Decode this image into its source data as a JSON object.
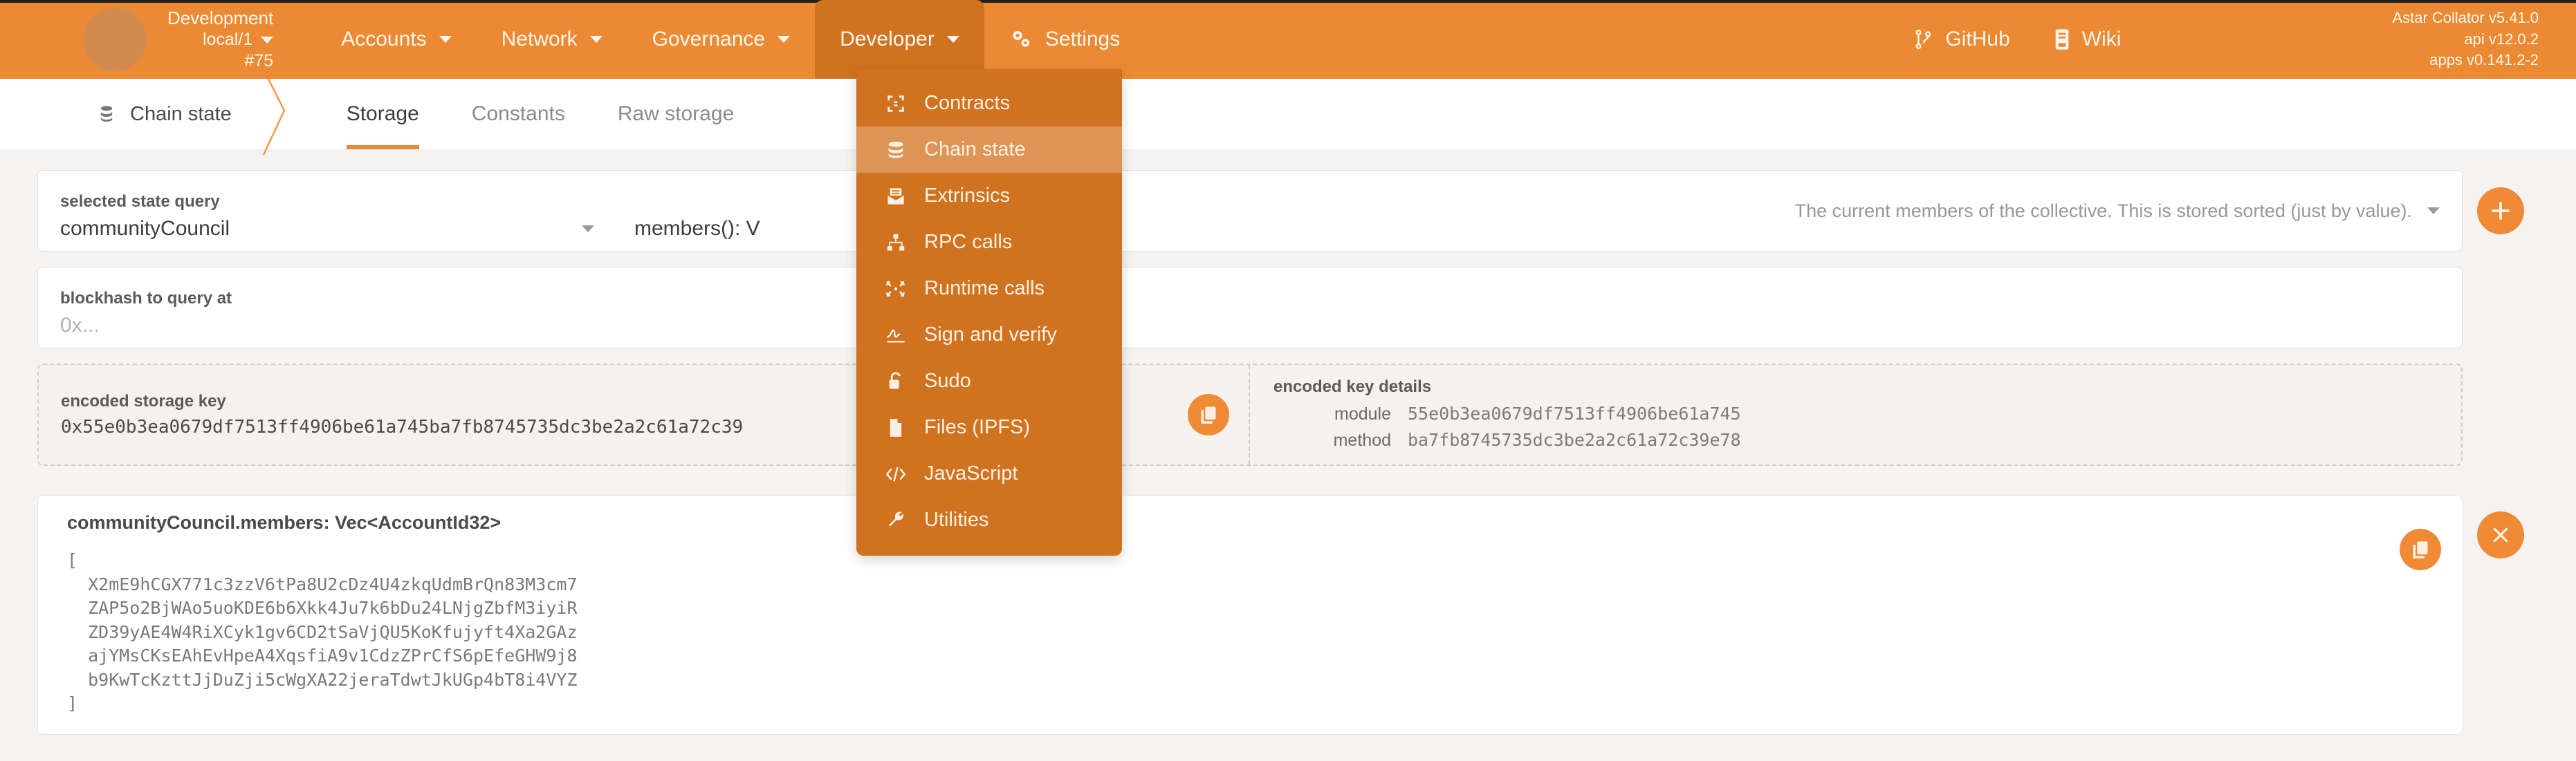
{
  "header": {
    "chain": {
      "name": "Development",
      "node": "local/1",
      "block": "#75"
    },
    "nav": [
      {
        "label": "Accounts",
        "has_caret": true,
        "active": false
      },
      {
        "label": "Network",
        "has_caret": true,
        "active": false
      },
      {
        "label": "Governance",
        "has_caret": true,
        "active": false
      },
      {
        "label": "Developer",
        "has_caret": true,
        "active": true
      },
      {
        "label": "Settings",
        "has_caret": false,
        "active": false,
        "icon": "gears-icon"
      }
    ],
    "links": [
      {
        "label": "GitHub",
        "icon": "git-branch-icon"
      },
      {
        "label": "Wiki",
        "icon": "book-icon"
      }
    ],
    "versions": {
      "client": "Astar Collator v5.41.0",
      "api": "api v12.0.2",
      "apps": "apps v0.141.2-2"
    }
  },
  "developer_menu": {
    "items": [
      {
        "label": "Contracts",
        "icon": "contracts-icon",
        "selected": false
      },
      {
        "label": "Chain state",
        "icon": "database-icon",
        "selected": true
      },
      {
        "label": "Extrinsics",
        "icon": "envelope-icon",
        "selected": false
      },
      {
        "label": "RPC calls",
        "icon": "sitemap-icon",
        "selected": false
      },
      {
        "label": "Runtime calls",
        "icon": "compress-arrows-icon",
        "selected": false
      },
      {
        "label": "Sign and verify",
        "icon": "signature-icon",
        "selected": false
      },
      {
        "label": "Sudo",
        "icon": "unlock-icon",
        "selected": false
      },
      {
        "label": "Files (IPFS)",
        "icon": "file-icon",
        "selected": false
      },
      {
        "label": "JavaScript",
        "icon": "code-icon",
        "selected": false
      },
      {
        "label": "Utilities",
        "icon": "wrench-icon",
        "selected": false
      }
    ]
  },
  "tabbar": {
    "section": {
      "label": "Chain state",
      "icon": "database-icon"
    },
    "tabs": [
      {
        "label": "Storage",
        "active": true
      },
      {
        "label": "Constants",
        "active": false
      },
      {
        "label": "Raw storage",
        "active": false
      }
    ]
  },
  "query": {
    "label": "selected state query",
    "module": "communityCouncil",
    "method": "members(): V",
    "description": "The current members of the collective. This is stored sorted (just by value).",
    "add_label": "+"
  },
  "blockhash": {
    "label": "blockhash to query at",
    "placeholder": "0x...",
    "value": ""
  },
  "encoded_key": {
    "label": "encoded storage key",
    "value": "0x55e0b3ea0679df7513ff4906be61a745ba7fb8745735dc3be2a2c61a72c39",
    "copy_icon": "copy-icon"
  },
  "key_details": {
    "label": "encoded key details",
    "rows": [
      {
        "key": "module",
        "value": "55e0b3ea0679df7513ff4906be61a745"
      },
      {
        "key": "method",
        "value": "ba7fb8745735dc3be2a2c61a72c39e78"
      }
    ]
  },
  "result": {
    "title": "communityCouncil.members: Vec<AccountId32>",
    "lines": [
      "[",
      "  X2mE9hCGX771c3zzV6tPa8U2cDz4U4zkqUdmBrQn83M3cm7",
      "  ZAP5o2BjWAo5uoKDE6b6Xkk4Ju7k6bDu24LNjgZbfM3iyiR",
      "  ZD39yAE4W4RiXCyk1gv6CD2tSaVjQU5KoKfujyft4Xa2GAz",
      "  ajYMsCKsEAhEvHpeA4XqsfiA9v1CdzZPrCfS6pEfeGHW9j8",
      "  b9KwTcKzttJjDuZji5cWgXA22jeraTdwtJkUGp4bT8i4VYZ",
      "]"
    ],
    "copy_icon": "copy-icon",
    "close_icon": "close-icon"
  },
  "colors": {
    "brand_orange": "#ec8a33",
    "brand_dark": "#cf7320",
    "menu_selected": "#dd9456",
    "page_bg": "#f5f3f1",
    "card_bg": "#ffffff"
  }
}
